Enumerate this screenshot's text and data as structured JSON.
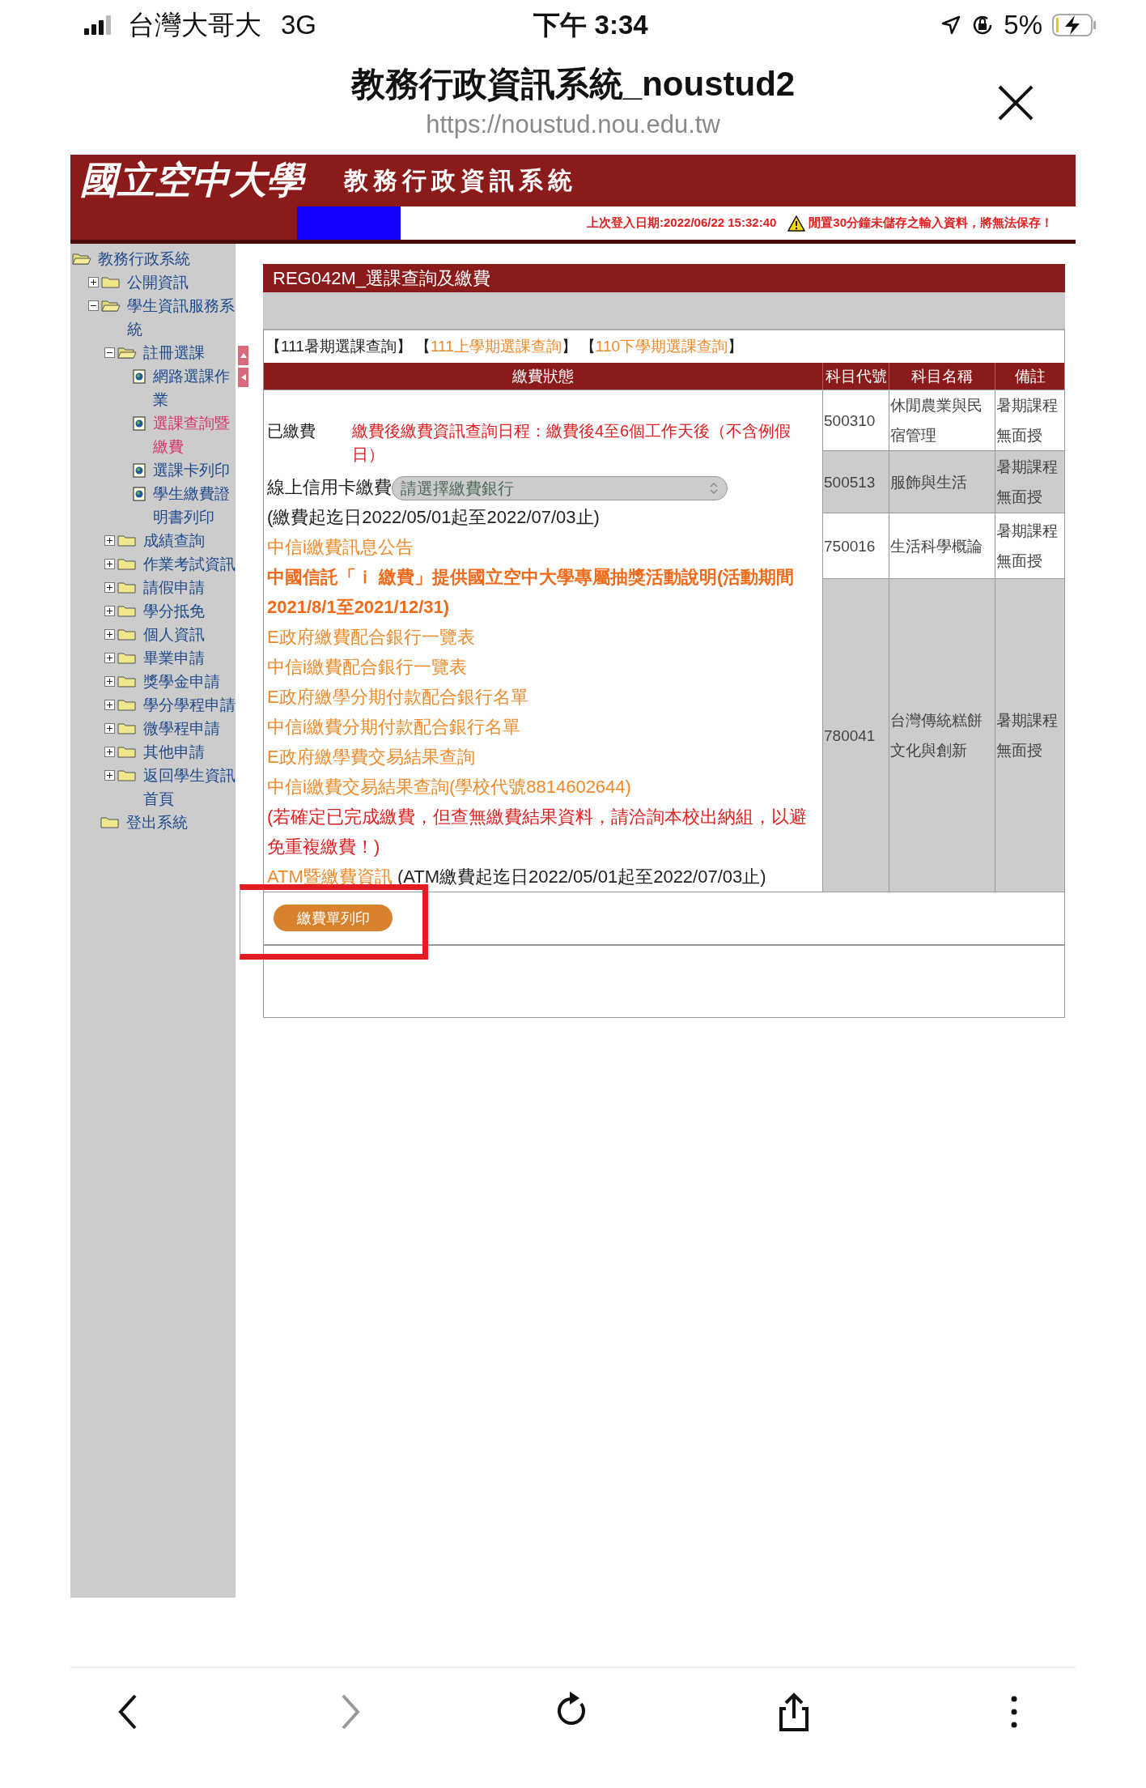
{
  "status_bar": {
    "carrier": "台灣大哥大",
    "network": "3G",
    "time": "下午 3:34",
    "battery": "5%"
  },
  "browser": {
    "title": "教務行政資訊系統_noustud2",
    "url": "https://noustud.nou.edu.tw"
  },
  "banner": {
    "logo": "國立空中大學",
    "system_name": "教務行政資訊系統",
    "last_login": "上次登入日期:2022/06/22 15:32:40",
    "warning": "閒置30分鐘未儲存之輸入資料，將無法保存！"
  },
  "sidebar": {
    "tree": [
      {
        "label": "教務行政系統",
        "kind": "root",
        "expanded": true,
        "selected": false,
        "children": [
          {
            "label": "公開資訊",
            "kind": "folder",
            "expanded": false,
            "selected": false
          },
          {
            "label": "學生資訊服務系統",
            "kind": "folder",
            "expanded": true,
            "selected": false,
            "children": [
              {
                "label": "註冊選課",
                "kind": "folder",
                "expanded": true,
                "selected": false,
                "children": [
                  {
                    "label": "網路選課作業",
                    "kind": "page",
                    "selected": false
                  },
                  {
                    "label": "選課查詢暨繳費",
                    "kind": "page",
                    "selected": true
                  },
                  {
                    "label": "選課卡列印",
                    "kind": "page",
                    "selected": false
                  },
                  {
                    "label": "學生繳費證明書列印",
                    "kind": "page",
                    "selected": false
                  }
                ]
              },
              {
                "label": "成績查詢",
                "kind": "folder",
                "expanded": false,
                "selected": false
              },
              {
                "label": "作業考試資訊",
                "kind": "folder",
                "expanded": false,
                "selected": false
              },
              {
                "label": "請假申請",
                "kind": "folder",
                "expanded": false,
                "selected": false
              },
              {
                "label": "學分抵免",
                "kind": "folder",
                "expanded": false,
                "selected": false
              },
              {
                "label": "個人資訊",
                "kind": "folder",
                "expanded": false,
                "selected": false
              },
              {
                "label": "畢業申請",
                "kind": "folder",
                "expanded": false,
                "selected": false
              },
              {
                "label": "獎學金申請",
                "kind": "folder",
                "expanded": false,
                "selected": false
              },
              {
                "label": "學分學程申請",
                "kind": "folder",
                "expanded": false,
                "selected": false
              },
              {
                "label": "微學程申請",
                "kind": "folder",
                "expanded": false,
                "selected": false
              },
              {
                "label": "其他申請",
                "kind": "folder",
                "expanded": false,
                "selected": false
              },
              {
                "label": "返回學生資訊首頁",
                "kind": "folder",
                "expanded": false,
                "selected": false
              }
            ]
          },
          {
            "label": "登出系統",
            "kind": "exit",
            "expanded": false,
            "selected": false
          }
        ]
      }
    ]
  },
  "main": {
    "title": "REG042M_選課查詢及繳費",
    "tab_brackets": [
      "【",
      "】"
    ],
    "tabs": [
      {
        "label": "111暑期選課查詢",
        "selected": true
      },
      {
        "label": "111上學期選課查詢",
        "selected": false
      },
      {
        "label": "110下學期選課查詢",
        "selected": false
      }
    ],
    "payment": {
      "header": "繳費狀態",
      "status": "已繳費",
      "status_note": "繳費後繳費資訊查詢日程：繳費後4至6個工作天後（不含例假日）",
      "credit_label": "線上信用卡繳費",
      "bank_select": {
        "placeholder": "請選擇繳費銀行"
      },
      "credit_note": "(繳費起迄日2022/05/01起至2022/07/03止)",
      "links": [
        {
          "text": "中信i繳費訊息公告",
          "kind": "link"
        },
        {
          "text": "中國信託「ｉ 繳費」提供國立空中大學專屬抽獎活動說明(活動期間2021/8/1至2021/12/31)",
          "kind": "bold_link"
        },
        {
          "text": "E政府繳費配合銀行一覽表",
          "kind": "link"
        },
        {
          "text": "中信i繳費配合銀行一覽表",
          "kind": "link"
        },
        {
          "text": "E政府繳學分期付款配合銀行名單",
          "kind": "link"
        },
        {
          "text": "中信i繳費分期付款配合銀行名單",
          "kind": "link"
        },
        {
          "text": "E政府繳學費交易結果查詢",
          "kind": "link"
        },
        {
          "text": "中信i繳費交易結果查詢(學校代號8814602644)",
          "kind": "link"
        },
        {
          "text": "(若確定已完成繳費，但查無繳費結果資料，請洽詢本校出納組，以避免重複繳費！)",
          "kind": "warning"
        }
      ],
      "atm_link": "ATM暨繳費資訊",
      "atm_note": " (ATM繳費起迄日2022/05/01起至2022/07/03止)"
    },
    "courses": {
      "columns": [
        "科目代號",
        "科目名稱",
        "備註"
      ],
      "rows": [
        {
          "code": "500310",
          "name": "休閒農業與民宿管理",
          "note": "暑期課程無面授"
        },
        {
          "code": "500513",
          "name": "服飾與生活",
          "note": "暑期課程無面授"
        },
        {
          "code": "750016",
          "name": "生活科學概論",
          "note": "暑期課程無面授"
        },
        {
          "code": "780041",
          "name": "台灣傳統糕餅文化與創新",
          "note": "暑期課程無面授"
        }
      ]
    },
    "print_button": "繳費單列印"
  },
  "nav": [
    {
      "kind": "back",
      "disabled": false
    },
    {
      "kind": "forward",
      "disabled": true
    },
    {
      "kind": "reload",
      "disabled": false
    },
    {
      "kind": "share",
      "disabled": false
    },
    {
      "kind": "more",
      "disabled": false
    }
  ]
}
